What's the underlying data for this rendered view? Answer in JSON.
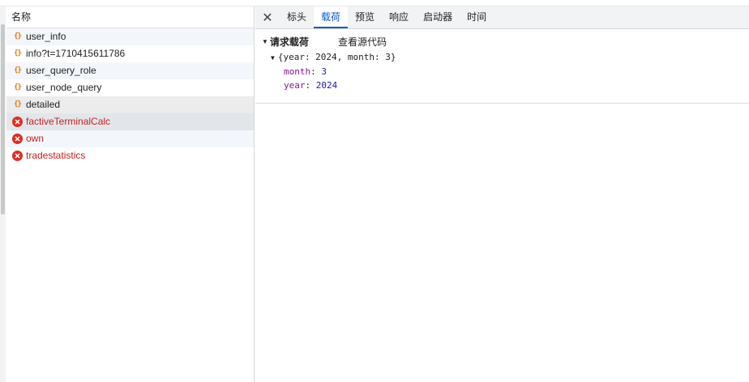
{
  "list": {
    "header": "名称",
    "items": [
      {
        "name": "user_info",
        "type": "xhr"
      },
      {
        "name": "info?t=1710415611786",
        "type": "xhr"
      },
      {
        "name": "user_query_role",
        "type": "xhr"
      },
      {
        "name": "user_node_query",
        "type": "xhr"
      },
      {
        "name": "detailed",
        "type": "xhr"
      },
      {
        "name": "factiveTerminalCalc",
        "type": "error"
      },
      {
        "name": "own",
        "type": "error"
      },
      {
        "name": "tradestatistics",
        "type": "error"
      }
    ]
  },
  "tabs": {
    "close": "✕",
    "items": [
      "标头",
      "载荷",
      "预览",
      "响应",
      "启动器",
      "时间"
    ],
    "active": "载荷"
  },
  "payload": {
    "section_title": "请求载荷",
    "view_source": "查看源代码",
    "summary": "{year: 2024, month: 3}",
    "props": [
      {
        "key": "month",
        "value": "3"
      },
      {
        "key": "year",
        "value": "2024"
      }
    ]
  },
  "colors": {
    "accent": "#0b57d0",
    "error": "#d93025",
    "xhr_icon": "#e37400"
  }
}
